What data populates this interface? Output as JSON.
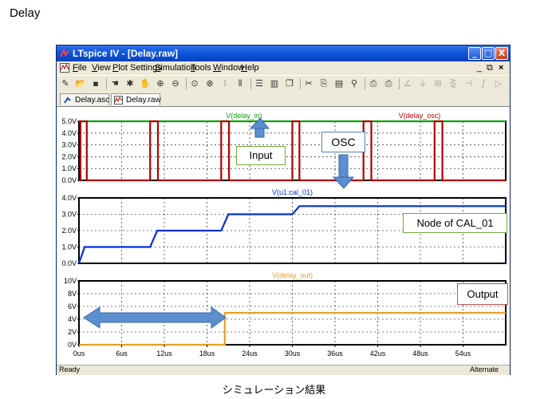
{
  "document": {
    "title": "Delay",
    "caption": "シミュレーション結果"
  },
  "window": {
    "title": "LTspice IV - [Delay.raw]",
    "controls": {
      "minimize": "_",
      "maximize": "□",
      "close": "X"
    },
    "mdi_controls": {
      "minimize": "_",
      "restore": "⧉",
      "close": "×"
    }
  },
  "menu": [
    {
      "label": "File",
      "accel": "F",
      "rest": "ile"
    },
    {
      "label": "View",
      "accel": "V",
      "rest": "iew"
    },
    {
      "label": "Plot Settings",
      "accel": "P",
      "rest": "lot Settings"
    },
    {
      "label": "Simulation",
      "accel": "S",
      "rest": "imulation"
    },
    {
      "label": "Tools",
      "accel": "T",
      "rest": "ools"
    },
    {
      "label": "Window",
      "accel": "W",
      "rest": "indow"
    },
    {
      "label": "Help",
      "accel": "H",
      "rest": "elp"
    }
  ],
  "toolbar": {
    "icons": [
      "new-schematic-icon",
      "open-icon",
      "save-icon",
      "control-panel-icon",
      "run-icon",
      "pan-icon",
      "zoom-in-icon",
      "zoom-out-icon",
      "zoom-fit-icon",
      "zoom-cancel-icon",
      "autorange-icon",
      "pick-visible-traces-icon",
      "tile-horizontal-icon",
      "tile-vertical-icon",
      "cascade-icon",
      "cut-icon",
      "copy-icon",
      "paste-icon",
      "find-icon",
      "print-setup-icon",
      "print-icon",
      "wire-icon",
      "ground-icon",
      "label-net-icon",
      "resistor-icon",
      "capacitor-icon",
      "inductor-icon",
      "diode-icon"
    ]
  },
  "tabs": [
    {
      "label": "Delay.asc",
      "icon": "schematic-icon",
      "active": false
    },
    {
      "label": "Delay.raw",
      "icon": "waveform-icon",
      "active": true
    }
  ],
  "plot": {
    "x_ticks": [
      "0us",
      "6us",
      "12us",
      "18us",
      "24us",
      "30us",
      "36us",
      "42us",
      "48us",
      "54us"
    ],
    "x_values": [
      0,
      6,
      12,
      18,
      24,
      30,
      36,
      42,
      48,
      54
    ],
    "x_range": [
      0,
      60
    ],
    "panes": [
      {
        "traces": [
          {
            "name": "V(delay_in)",
            "color": "#00a000",
            "points": [
              [
                0,
                5
              ],
              [
                60,
                5
              ]
            ]
          },
          {
            "name": "V(delay_osc)",
            "color": "#b00000",
            "points": [
              [
                0,
                0
              ],
              [
                0.2,
                0
              ],
              [
                0.2,
                5
              ],
              [
                1.1,
                5
              ],
              [
                1.1,
                0
              ],
              [
                10,
                0
              ],
              [
                10,
                5
              ],
              [
                11.1,
                5
              ],
              [
                11.1,
                0
              ],
              [
                20,
                0
              ],
              [
                20,
                5
              ],
              [
                21.1,
                5
              ],
              [
                21.1,
                0
              ],
              [
                30,
                0
              ],
              [
                30,
                5
              ],
              [
                31,
                5
              ],
              [
                31,
                0
              ],
              [
                40,
                0
              ],
              [
                40,
                5
              ],
              [
                41.1,
                5
              ],
              [
                41.1,
                0
              ],
              [
                50,
                0
              ],
              [
                50,
                5
              ],
              [
                51.1,
                5
              ],
              [
                51.1,
                0
              ],
              [
                60,
                0
              ]
            ]
          }
        ],
        "y_ticks": [
          "0.0V",
          "1.0V",
          "2.0V",
          "3.0V",
          "4.0V",
          "5.0V"
        ],
        "y_values": [
          0,
          1,
          2,
          3,
          4,
          5
        ],
        "y_range": [
          0,
          5
        ]
      },
      {
        "traces": [
          {
            "name": "V(u1:cal_01)",
            "color": "#0030e0",
            "points": [
              [
                0,
                0
              ],
              [
                0.8,
                1
              ],
              [
                10,
                1
              ],
              [
                11,
                2
              ],
              [
                20,
                2
              ],
              [
                21,
                3
              ],
              [
                30,
                3
              ],
              [
                31,
                3.5
              ],
              [
                60,
                3.5
              ]
            ]
          }
        ],
        "y_ticks": [
          "0.0V",
          "1.0V",
          "2.0V",
          "3.0V",
          "4.0V"
        ],
        "y_values": [
          0,
          1,
          2,
          3,
          4
        ],
        "y_range": [
          0,
          4
        ]
      },
      {
        "traces": [
          {
            "name": "V(delay_out)",
            "color": "#e8a020",
            "points": [
              [
                0,
                0
              ],
              [
                20.5,
                0
              ],
              [
                20.5,
                5
              ],
              [
                60,
                5
              ]
            ]
          }
        ],
        "y_ticks": [
          "0V",
          "2V",
          "4V",
          "6V",
          "8V",
          "10V"
        ],
        "y_values": [
          0,
          2,
          4,
          6,
          8,
          10
        ],
        "y_range": [
          0,
          10
        ]
      }
    ]
  },
  "annotations": {
    "input": "Input",
    "osc": "OSC",
    "node": "Node of CAL_01",
    "output": "Output"
  },
  "status": {
    "left": "Ready",
    "right": "Alternate"
  }
}
